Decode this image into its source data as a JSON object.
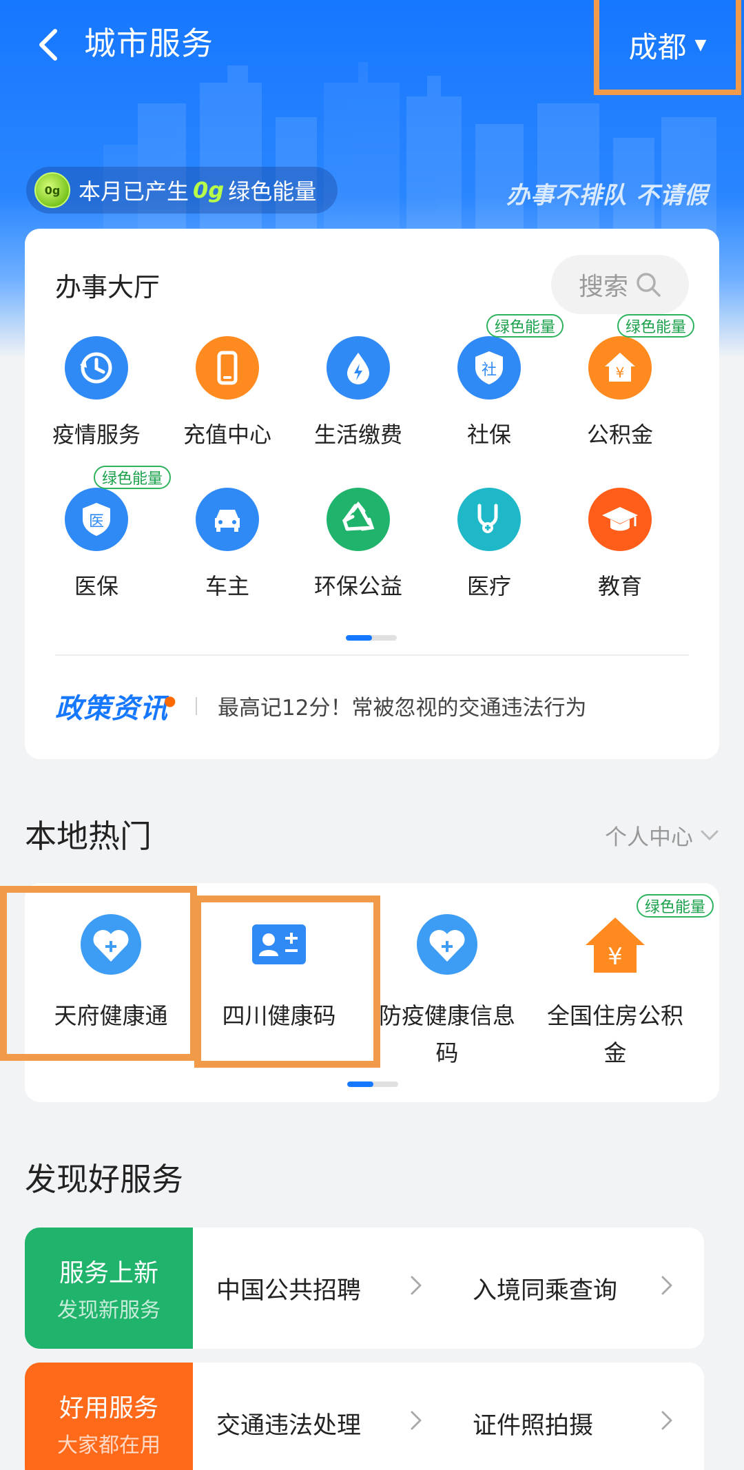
{
  "header": {
    "title": "城市服务",
    "city": "成都",
    "energy_prefix": "本月已产生",
    "energy_value": "0g",
    "energy_suffix": "绿色能量",
    "energy_badge": "0g",
    "slogan": "办事不排队 不请假"
  },
  "hall": {
    "title": "办事大厅",
    "search_placeholder": "搜索",
    "items": [
      {
        "label": "疫情服务",
        "icon": "clock-history-icon",
        "color": "#2f8af5"
      },
      {
        "label": "充值中心",
        "icon": "phone-icon",
        "color": "#ff8a1f"
      },
      {
        "label": "生活缴费",
        "icon": "water-drop-icon",
        "color": "#2f8af5"
      },
      {
        "label": "社保",
        "icon": "social-security-shield-icon",
        "color": "#2f8af5",
        "tag": "绿色能量"
      },
      {
        "label": "公积金",
        "icon": "housing-fund-icon",
        "color": "#ff8a1f",
        "tag": "绿色能量"
      },
      {
        "label": "医保",
        "icon": "medical-insurance-shield-icon",
        "color": "#2f8af5",
        "tag": "绿色能量"
      },
      {
        "label": "车主",
        "icon": "car-icon",
        "color": "#2f8af5"
      },
      {
        "label": "环保公益",
        "icon": "recycle-icon",
        "color": "#1fb36b"
      },
      {
        "label": "医疗",
        "icon": "stethoscope-icon",
        "color": "#1fb8c8"
      },
      {
        "label": "教育",
        "icon": "graduation-cap-icon",
        "color": "#ff5e1a"
      }
    ],
    "pager": {
      "pages": 2,
      "active": 1
    },
    "policy_logo": "政策资讯",
    "policy_text": "最高记12分！常被忽视的交通违法行为"
  },
  "hot": {
    "title": "本地热门",
    "personal_center": "个人中心",
    "items": [
      {
        "label": "天府健康通",
        "icon": "heart-plus-icon",
        "color": "#3d9df5"
      },
      {
        "label": "四川健康码",
        "icon": "id-card-icon",
        "color": "#2f8af5"
      },
      {
        "label": "防疫健康信息码",
        "icon": "heart-plus-icon",
        "color": "#3d9df5"
      },
      {
        "label": "全国住房公积金",
        "icon": "house-yuan-icon",
        "color": "#ff8a1f",
        "tag": "绿色能量"
      }
    ]
  },
  "discover": {
    "title": "发现好服务",
    "rows": [
      {
        "badge_title": "服务上新",
        "badge_sub": "发现新服务",
        "color": "#1fb36b",
        "links": [
          "中国公共招聘",
          "入境同乘查询"
        ]
      },
      {
        "badge_title": "好用服务",
        "badge_sub": "大家都在用",
        "color": "#ff6a1a",
        "links": [
          "交通违法处理",
          "证件照拍摄"
        ]
      }
    ]
  },
  "colors": {
    "primary": "#1677ff",
    "highlight": "#f09a4a",
    "energy_green": "#18a04a"
  }
}
